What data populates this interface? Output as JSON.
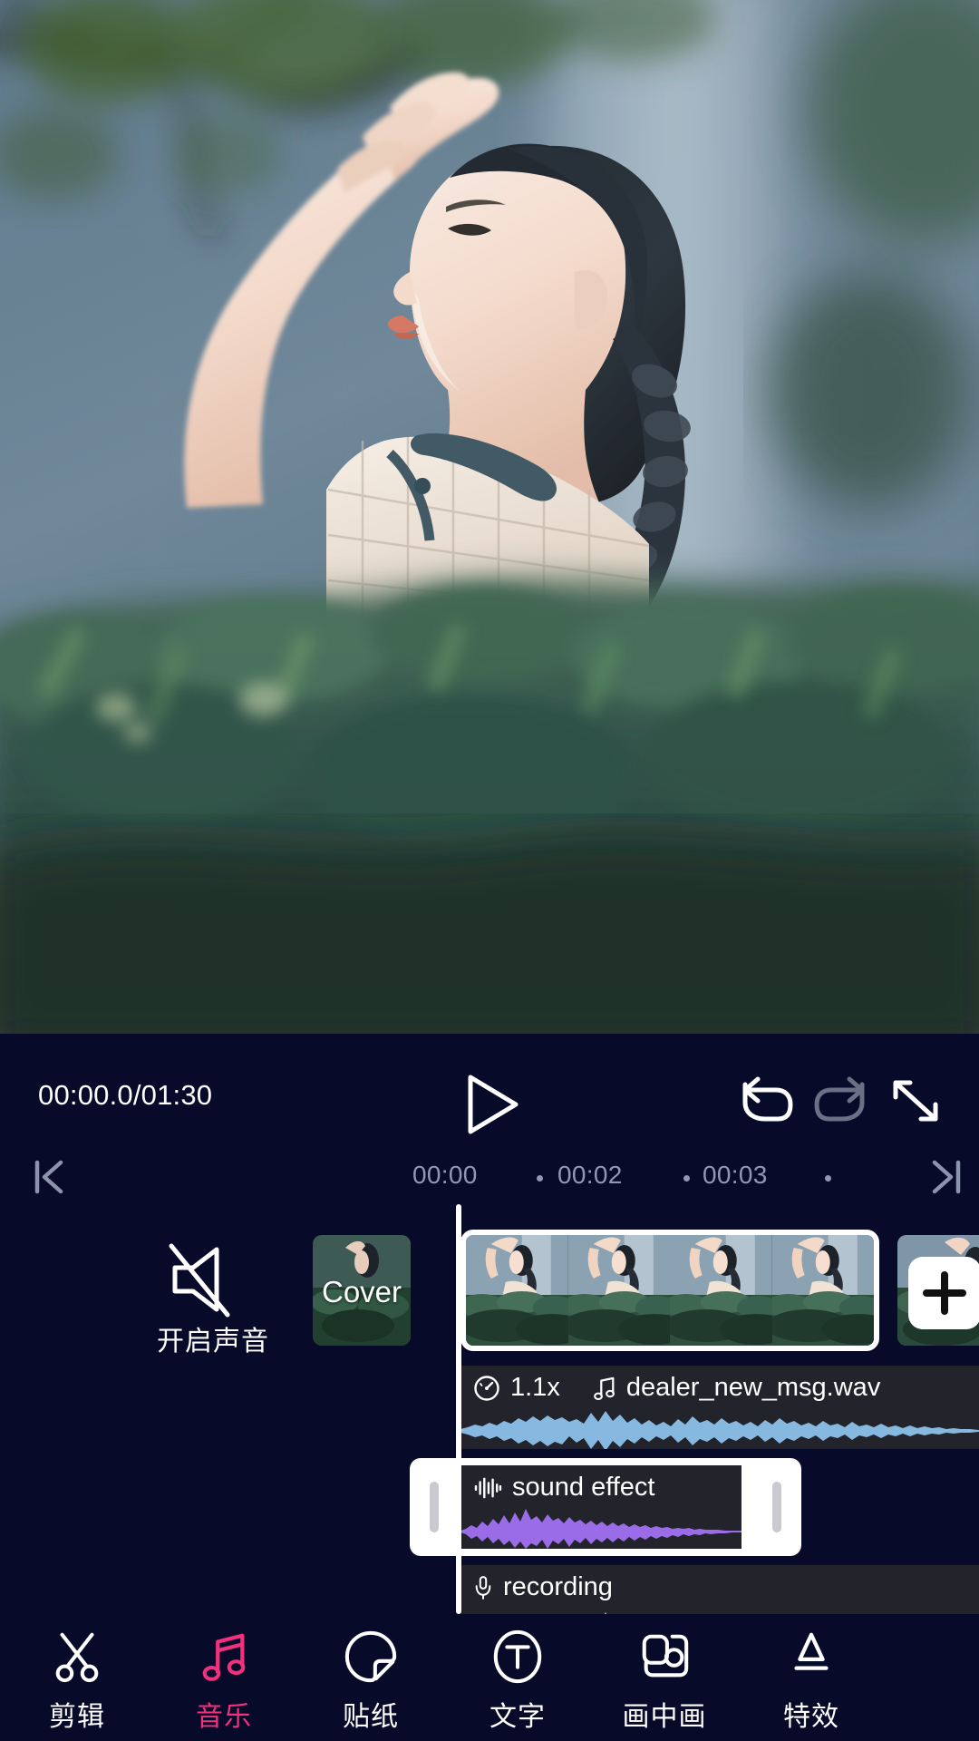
{
  "app": {
    "theme_bg": "#070a28",
    "accent": "#f2317e"
  },
  "preview": {
    "name": "video-preview",
    "description": "Young woman in profile shielding eyes with hand, braided hair, blurred blue-gray wall and green hedge"
  },
  "controls": {
    "timecode": "00:00.0/01:30",
    "current_time": "00:00.0",
    "total_time": "01:30",
    "play_icon": "play-icon",
    "undo_icon": "undo-icon",
    "redo_icon": "redo-icon",
    "fullscreen_icon": "fullscreen-icon",
    "undo_enabled": true,
    "redo_enabled": false
  },
  "ruler": {
    "skip_start_icon": "skip-to-start-icon",
    "skip_end_icon": "skip-to-end-icon",
    "ticks": [
      "00:00",
      "00:02",
      "00:03"
    ],
    "tick_positions": [
      455,
      615,
      775
    ],
    "dot_positions": [
      592,
      754,
      910
    ]
  },
  "timeline": {
    "mute_button": {
      "label": "开启声音",
      "icon": "speaker-muted-icon"
    },
    "cover_clip": {
      "label": "Cover"
    },
    "video_clip": {
      "selected": true,
      "frame_count": 4
    },
    "add_clip": {
      "icon": "plus-icon"
    },
    "tracks": [
      {
        "name": "music-track",
        "speed": "1.1x",
        "speed_icon": "speedometer-icon",
        "type_icon": "music-note-icon",
        "title": "dealer_new_msg.wav",
        "wave_color": "#87b9e0",
        "selected": false
      },
      {
        "name": "sound-effect-track",
        "type_icon": "sound-wave-icon",
        "title": "sound effect",
        "wave_color": "#9b6ce8",
        "selected": true
      },
      {
        "name": "recording-track",
        "type_icon": "microphone-icon",
        "title": "recording",
        "wave_color": "#90ce8c",
        "selected": false
      }
    ]
  },
  "bottom_nav": {
    "items": [
      {
        "label": "剪辑",
        "icon": "scissors-icon",
        "active": false
      },
      {
        "label": "音乐",
        "icon": "music-note-icon",
        "active": true
      },
      {
        "label": "贴纸",
        "icon": "sticker-icon",
        "active": false
      },
      {
        "label": "文字",
        "icon": "text-circle-icon",
        "active": false
      },
      {
        "label": "画中画",
        "icon": "picture-in-picture-icon",
        "active": false
      },
      {
        "label": "特效",
        "icon": "effects-icon",
        "active": false
      }
    ]
  }
}
